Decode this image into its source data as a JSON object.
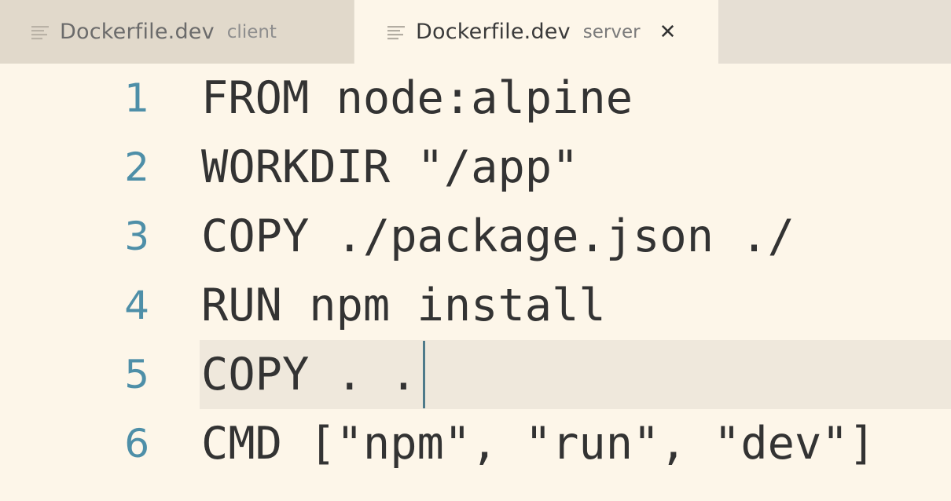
{
  "tabs": [
    {
      "title": "Dockerfile.dev",
      "description": "client",
      "active": false
    },
    {
      "title": "Dockerfile.dev",
      "description": "server",
      "active": true,
      "close_glyph": "✕"
    }
  ],
  "editor": {
    "lines": [
      {
        "number": "1",
        "text": "FROM node:alpine"
      },
      {
        "number": "2",
        "text": "WORKDIR \"/app\""
      },
      {
        "number": "3",
        "text": "COPY ./package.json ./"
      },
      {
        "number": "4",
        "text": "RUN npm install"
      },
      {
        "number": "5",
        "text": "COPY . ."
      },
      {
        "number": "6",
        "text": "CMD [\"npm\", \"run\", \"dev\"]"
      }
    ],
    "current_line": 5
  },
  "colors": {
    "background": "#fdf6e9",
    "tabbar": "#e6dfd4",
    "line_number": "#4e8fa8",
    "text": "#333333",
    "current_line_highlight": "#efe8dc"
  }
}
